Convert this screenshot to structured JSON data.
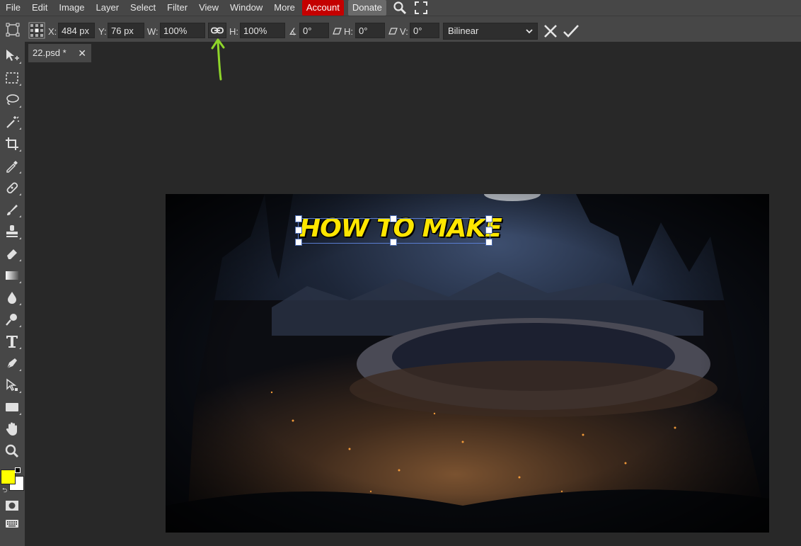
{
  "menu": {
    "items": [
      "File",
      "Edit",
      "Image",
      "Layer",
      "Select",
      "Filter",
      "View",
      "Window",
      "More"
    ],
    "account": "Account",
    "donate": "Donate"
  },
  "options": {
    "x_label": "X:",
    "x_value": "484 px",
    "y_label": "Y:",
    "y_value": "76 px",
    "w_label": "W:",
    "w_value": "100%",
    "h_label": "H:",
    "h_value": "100%",
    "angle_value": "0°",
    "skew_h_label": "H:",
    "skew_h_value": "0°",
    "skew_v_label": "V:",
    "skew_v_value": "0°",
    "interpolation": "Bilinear"
  },
  "tab": {
    "name": "22.psd *",
    "close": "✕"
  },
  "canvas": {
    "headline": "HOW TO MAKE"
  },
  "colors": {
    "foreground": "#ffff00",
    "background": "#ffffff",
    "accent_arrow": "#8fd62a"
  }
}
